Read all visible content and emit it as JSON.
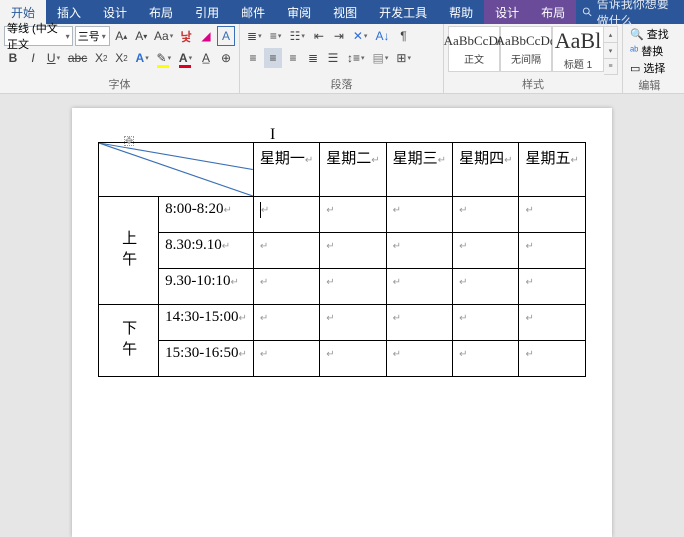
{
  "tabs": {
    "start": "开始",
    "insert": "插入",
    "design": "设计",
    "layout": "布局",
    "references": "引用",
    "mail": "邮件",
    "review": "审阅",
    "view": "视图",
    "dev": "开发工具",
    "help": "帮助",
    "ctx_design": "设计",
    "ctx_layout": "布局",
    "tellme_placeholder": "告诉我你想要做什么"
  },
  "font": {
    "family": "等线 (中文正文",
    "size": "三号",
    "group_label": "字体"
  },
  "para": {
    "group_label": "段落"
  },
  "styles": {
    "group_label": "样式",
    "normal_prev": "AaBbCcDd",
    "normal_lab": "正文",
    "nospace_prev": "AaBbCcDd",
    "nospace_lab": "无间隔",
    "h1_prev": "AaBl",
    "h1_lab": "标题 1"
  },
  "editing": {
    "find": "查找",
    "replace": "替换",
    "select": "选择",
    "group_label": "编辑"
  },
  "table": {
    "headers": [
      "星期一",
      "星期二",
      "星期三",
      "星期四",
      "星期五"
    ],
    "am_label": "上午",
    "pm_label": "下午",
    "rows": [
      {
        "time": "8:00-8:20",
        "section": "am"
      },
      {
        "time": "8.30:9.10",
        "section": "am"
      },
      {
        "time": "9.30-10:10",
        "section": "am"
      },
      {
        "time": "14:30-15:00",
        "section": "pm"
      },
      {
        "time": "15:30-16:50",
        "section": "pm"
      }
    ]
  }
}
